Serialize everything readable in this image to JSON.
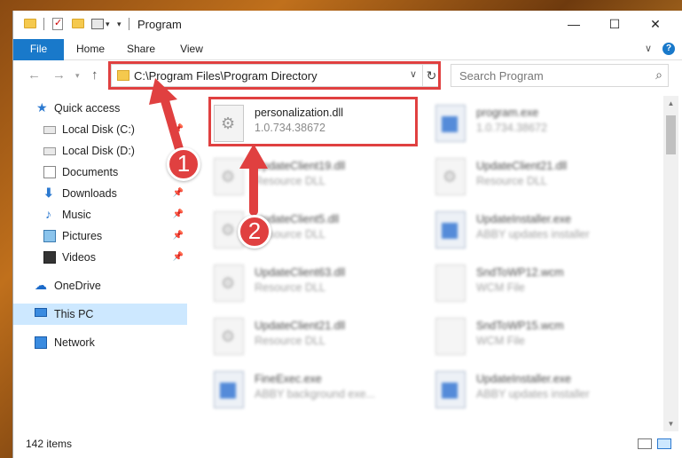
{
  "window": {
    "title": "Program"
  },
  "ribbon": {
    "tabs": [
      "File",
      "Home",
      "Share",
      "View"
    ]
  },
  "address": {
    "path": "C:\\Program Files\\Program Directory"
  },
  "search": {
    "placeholder": "Search Program"
  },
  "sidebar": {
    "items": [
      {
        "label": "Quick access",
        "icon": "star-icon",
        "pinned": false
      },
      {
        "label": "Local Disk (C:)",
        "icon": "drive-icon",
        "pinned": true
      },
      {
        "label": "Local Disk (D:)",
        "icon": "drive-icon",
        "pinned": false
      },
      {
        "label": "Documents",
        "icon": "documents-icon",
        "pinned": true
      },
      {
        "label": "Downloads",
        "icon": "download-icon",
        "pinned": true
      },
      {
        "label": "Music",
        "icon": "music-icon",
        "pinned": true
      },
      {
        "label": "Pictures",
        "icon": "pictures-icon",
        "pinned": true
      },
      {
        "label": "Videos",
        "icon": "videos-icon",
        "pinned": true
      },
      {
        "label": "OneDrive",
        "icon": "cloud-icon",
        "pinned": false
      },
      {
        "label": "This PC",
        "icon": "pc-icon",
        "pinned": false,
        "selected": true
      },
      {
        "label": "Network",
        "icon": "network-icon",
        "pinned": false
      }
    ]
  },
  "files": [
    {
      "name": "personalization.dll",
      "desc": "1.0.734.38672",
      "icon": "dll-gear-icon",
      "blurred": false
    },
    {
      "name": "program.exe",
      "desc": "1.0.734.38672",
      "icon": "exe-icon",
      "blurred": true
    },
    {
      "name": "UpdateClient19.dll",
      "desc": "Resource DLL",
      "icon": "dll-gear-icon",
      "blurred": true
    },
    {
      "name": "UpdateClient21.dll",
      "desc": "Resource DLL",
      "icon": "dll-gear-icon",
      "blurred": true
    },
    {
      "name": "UpdateClient5.dll",
      "desc": "Resource DLL",
      "icon": "dll-gear-icon",
      "blurred": true
    },
    {
      "name": "UpdateInstaller.exe",
      "desc": "ABBY updates installer",
      "icon": "exe-icon",
      "blurred": true
    },
    {
      "name": "UpdateClient63.dll",
      "desc": "Resource DLL",
      "icon": "dll-gear-icon",
      "blurred": true
    },
    {
      "name": "SndToWP12.wcm",
      "desc": "WCM File",
      "icon": "wcm-icon",
      "blurred": true
    },
    {
      "name": "UpdateClient21.dll",
      "desc": "Resource DLL",
      "icon": "dll-gear-icon",
      "blurred": true
    },
    {
      "name": "SndToWP15.wcm",
      "desc": "WCM File",
      "icon": "wcm-icon",
      "blurred": true
    },
    {
      "name": "FineExec.exe",
      "desc": "ABBY background exe...",
      "icon": "exe-icon",
      "blurred": true
    },
    {
      "name": "UpdateInstaller.exe",
      "desc": "ABBY updates installer",
      "icon": "exe-icon",
      "blurred": true
    }
  ],
  "status": {
    "count": "142 items"
  },
  "annotations": {
    "step1": "1",
    "step2": "2",
    "color": "#e04040"
  }
}
